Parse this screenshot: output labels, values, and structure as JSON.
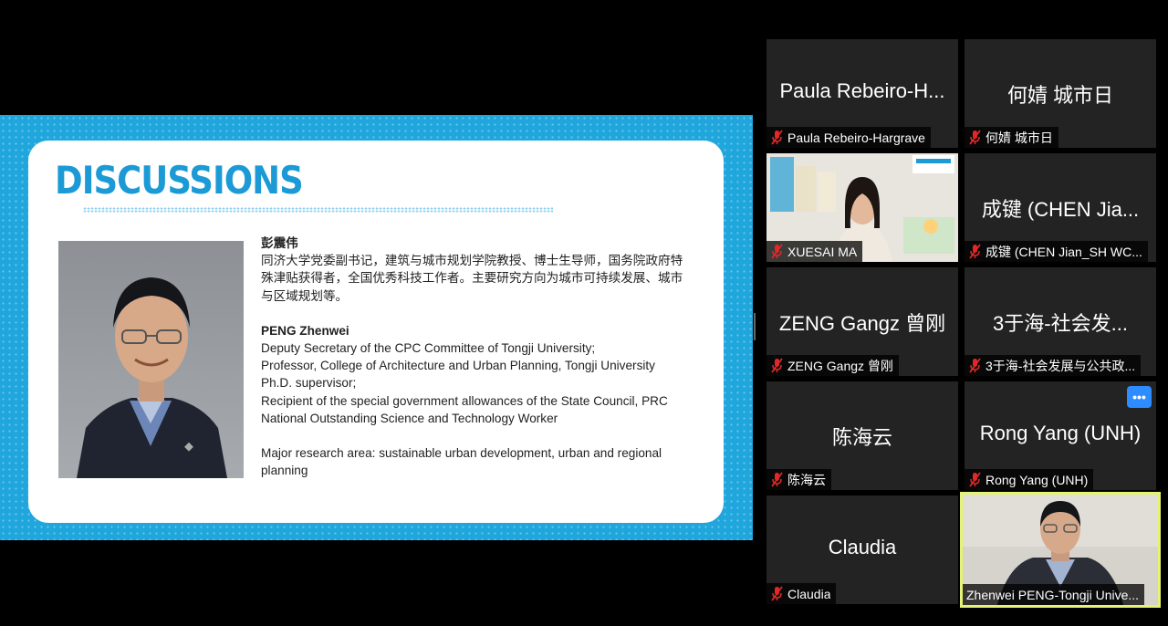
{
  "slide": {
    "title": "DISCUSSIONS",
    "cn_name": "彭震伟",
    "cn_bio": "同济大学党委副书记，建筑与城市规划学院教授、博士生导师，国务院政府特殊津贴获得者，全国优秀科技工作者。主要研究方向为城市可持续发展、城市与区域规划等。",
    "en_name": "PENG Zhenwei",
    "en_lines": [
      "Deputy Secretary of the CPC Committee of Tongji University;",
      "Professor, College of Architecture and Urban Planning, Tongji University",
      "Ph.D. supervisor;",
      "Recipient of the special government allowances of the State Council, PRC",
      "National Outstanding Science and Technology Worker"
    ],
    "research": "Major research area: sustainable urban development, urban and regional planning"
  },
  "participants": [
    {
      "display": "Paula Rebeiro-H...",
      "label": "Paula Rebeiro-Hargrave",
      "muted": true
    },
    {
      "display": "何婧 城市日",
      "label": "何婧 城市日",
      "muted": true
    },
    {
      "display": "",
      "label": "XUESAI MA",
      "muted": true,
      "video": true
    },
    {
      "display": "成键 (CHEN Jia...",
      "label": "成键 (CHEN Jian_SH WC...",
      "muted": true
    },
    {
      "display": "ZENG Gangz 曾刚",
      "label": "ZENG Gangz 曾刚",
      "muted": true
    },
    {
      "display": "3于海-社会发...",
      "label": "3于海-社会发展与公共政...",
      "muted": true
    },
    {
      "display": "陈海云",
      "label": "陈海云",
      "muted": true
    },
    {
      "display": "Rong Yang (UNH)",
      "label": "Rong Yang (UNH)",
      "muted": true,
      "more": "•••"
    },
    {
      "display": "Claudia",
      "label": "Claudia",
      "muted": true
    },
    {
      "display": "",
      "label": "Zhenwei PENG-Tongji Unive...",
      "muted": false,
      "video": true,
      "speaking": true
    }
  ],
  "colors": {
    "slide_bg": "#1fa6dc",
    "title": "#1b9ad6",
    "tile_bg": "#232323",
    "speaking_border": "#e5f273",
    "more_button": "#2d8cff",
    "mic_muted": "#e02828"
  }
}
